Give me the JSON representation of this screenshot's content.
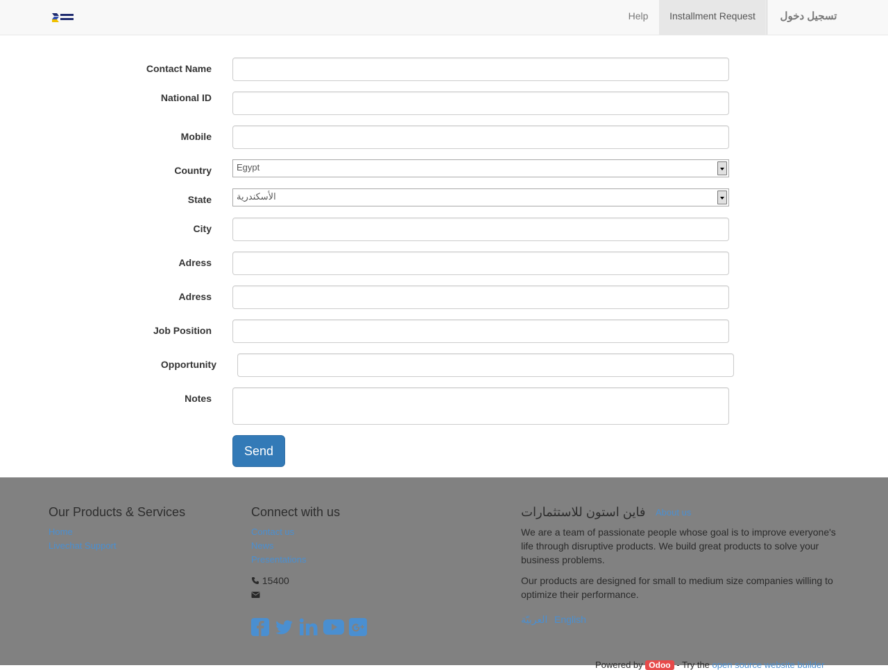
{
  "navbar": {
    "brand": {
      "logo": "fine-stone-logo"
    },
    "items": [
      {
        "label": "Help"
      },
      {
        "label": "Installment Request",
        "active": true
      },
      {
        "label": "تسجيل دخول"
      }
    ]
  },
  "form": {
    "fields": [
      {
        "label": "Contact Name",
        "value": ""
      },
      {
        "label": "National ID",
        "value": ""
      },
      {
        "label": "Mobile",
        "value": ""
      },
      {
        "label": "Country",
        "value": "Egypt"
      },
      {
        "label": "State",
        "value": "الأسكندرية"
      },
      {
        "label": "City",
        "value": ""
      },
      {
        "label": "Adress",
        "value": ""
      },
      {
        "label": "Adress",
        "value": ""
      },
      {
        "label": "Job Position",
        "value": ""
      },
      {
        "label": "Opportunity",
        "value": ""
      },
      {
        "label": "Notes",
        "value": ""
      }
    ],
    "submit_label": "Send"
  },
  "footer": {
    "products": {
      "title": "Our Products & Services",
      "links": [
        "Home",
        "Livechat Support"
      ]
    },
    "connect": {
      "title": "Connect with us",
      "links": [
        "Contact us",
        "News",
        "Presentations"
      ],
      "phone": "15400",
      "email": "",
      "social_icons": [
        "facebook-icon",
        "twitter-icon",
        "linkedin-icon",
        "youtube-icon",
        "google-plus-icon"
      ]
    },
    "about": {
      "company_name": "فاين استون للاستثمارات",
      "about_link": "About us",
      "paragraph1": "We are a team of passionate people whose goal is to improve everyone's life through disruptive products. We build great products to solve your business problems.",
      "paragraph2": "Our products are designed for small to medium size companies willing to optimize their performance.",
      "languages": [
        "العربيّة",
        "English"
      ]
    },
    "powered": {
      "prefix": "Powered by",
      "badge": "Odoo",
      "middle": "- Try the",
      "link": "open source website builder"
    }
  },
  "colors": {
    "primary": "#337ab7",
    "footer_bg": "#818181",
    "link": "#4a8fd1",
    "navbar_bg": "#f8f8f8"
  }
}
